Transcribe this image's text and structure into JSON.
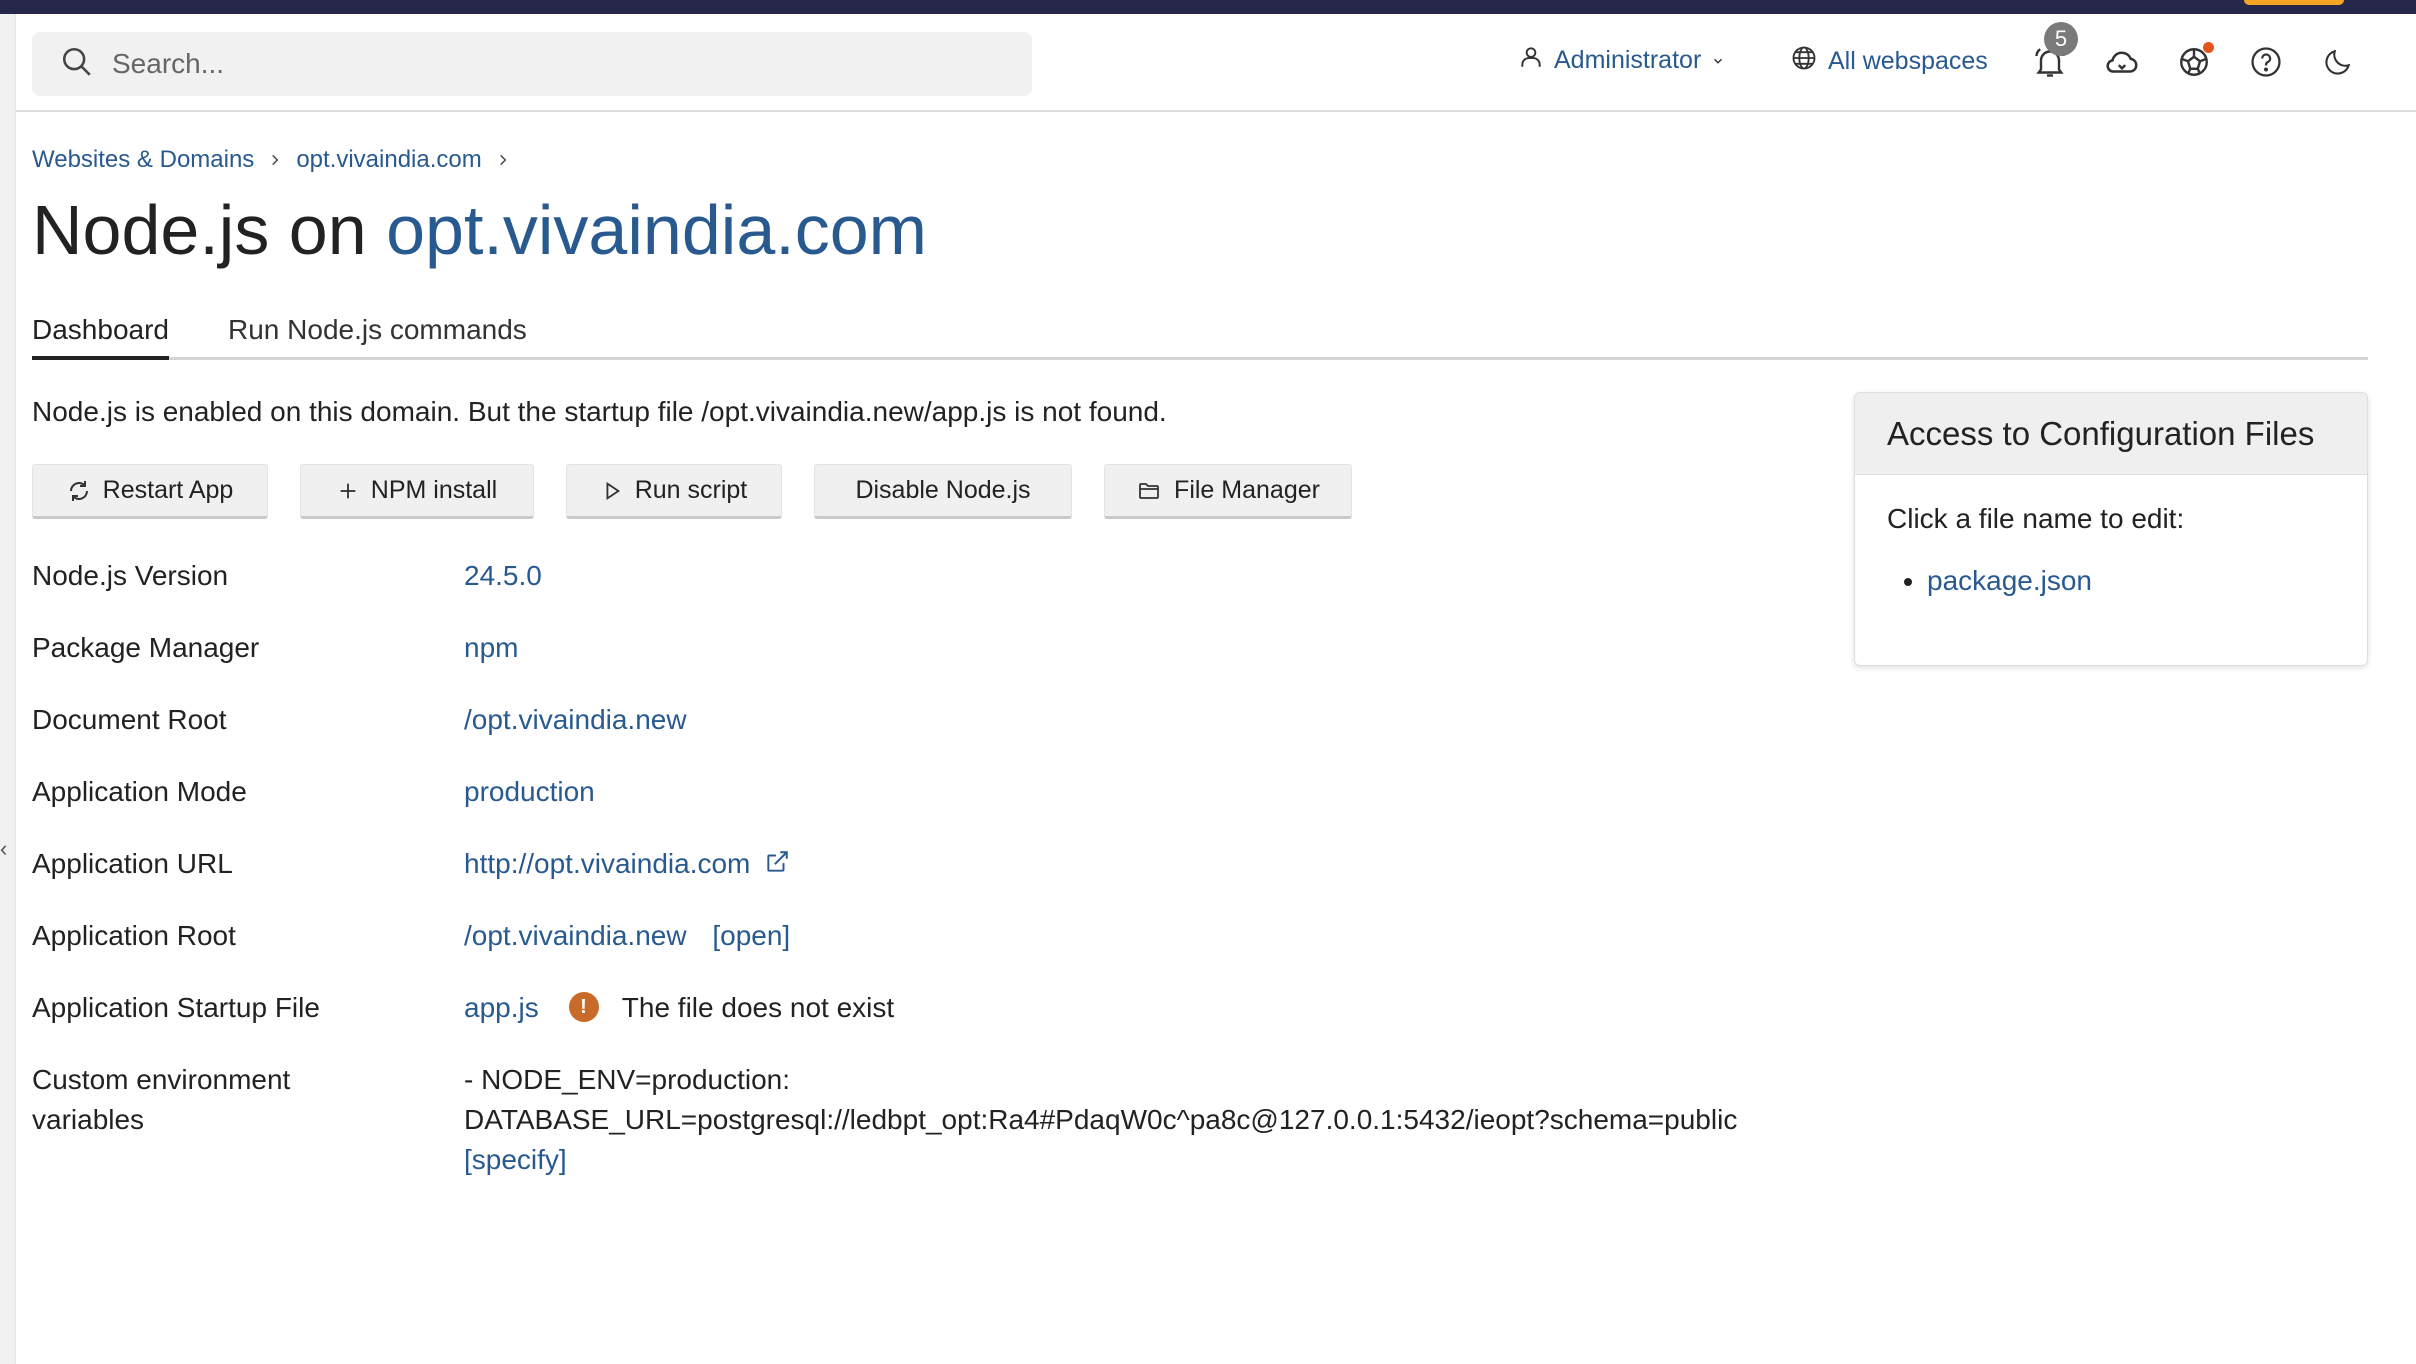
{
  "header": {
    "search_placeholder": "Search...",
    "user_label": "Administrator",
    "webspaces_label": "All webspaces",
    "notifications_count": "5",
    "accent_color": "#28598f",
    "badge_color": "#7a7a7a",
    "alert_dot_color": "#e5541b"
  },
  "breadcrumb": {
    "items": [
      "Websites & Domains",
      "opt.vivaindia.com"
    ]
  },
  "title": {
    "prefix": "Node.js on",
    "domain": "opt.vivaindia.com"
  },
  "tabs": [
    "Dashboard",
    "Run Node.js commands"
  ],
  "notice": "Node.js is enabled on this domain. But the startup file /opt.vivaindia.new/app.js is not found.",
  "buttons": {
    "restart": "Restart App",
    "npm_install": "NPM install",
    "run_script": "Run script",
    "disable": "Disable Node.js",
    "file_manager": "File Manager"
  },
  "properties": {
    "version": {
      "label": "Node.js Version",
      "value": "24.5.0"
    },
    "package_manager": {
      "label": "Package Manager",
      "value": "npm"
    },
    "document_root": {
      "label": "Document Root",
      "value": "/opt.vivaindia.new"
    },
    "mode": {
      "label": "Application Mode",
      "value": "production"
    },
    "url": {
      "label": "Application URL",
      "value": "http://opt.vivaindia.com"
    },
    "app_root": {
      "label": "Application Root",
      "value": "/opt.vivaindia.new",
      "action": "[open]"
    },
    "startup_file": {
      "label": "Application Startup File",
      "value": "app.js",
      "warning": "The file does not exist",
      "warning_color": "#c86b28"
    },
    "env_vars": {
      "label_line1": "Custom environment",
      "label_line2": "variables",
      "line1": "- NODE_ENV=production:",
      "line2": "DATABASE_URL=postgresql://ledbpt_opt:Ra4#PdaqW0c^pa8c@127.0.0.1:5432/ieopt?schema=public",
      "action": "[specify]"
    }
  },
  "config_panel": {
    "title": "Access to Configuration Files",
    "prompt": "Click a file name to edit:",
    "files": [
      "package.json"
    ]
  }
}
